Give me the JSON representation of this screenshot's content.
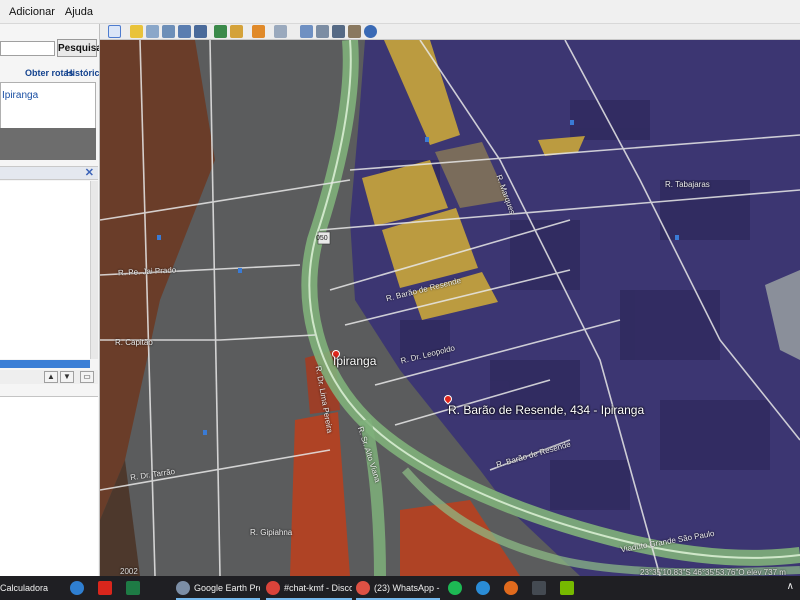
{
  "menu": {
    "items": [
      "Adicionar",
      "Ajuda"
    ]
  },
  "search": {
    "placeholder": "",
    "button_label": "Pesquisar"
  },
  "links": {
    "directions": "Obter rotas",
    "history": "Histórico"
  },
  "result": {
    "text": "Ipiranga"
  },
  "places_panel": {
    "close_glyph": "✕"
  },
  "map": {
    "labels": {
      "place": "Ipiranga",
      "address": "R. Barão de Resende, 434 - Ipiranga",
      "shield": "050"
    },
    "streets": [
      "R. Pe. Jai Prado",
      "R. Dr. Lima Pereira",
      "R. Dr. Tarrão",
      "R. Capitão",
      "R. Gipiahna",
      "R. Barão de Resende",
      "R. Dr. Leopoldo",
      "R. Barão de Resende",
      "R. Sr. Alto Viana",
      "Viaduto Grande São Paulo",
      "R. Tabajaras",
      "R. Marques"
    ],
    "year": "2002",
    "coords": "23°35'10.83\"S    46°35'53.76\"O    elev   737 m"
  },
  "taskbar": {
    "items": [
      {
        "label": "Calculadora",
        "color": "#3a3a3a"
      },
      {
        "label": "",
        "color": "#2f7fd1"
      },
      {
        "label": "",
        "color": "#d9261c"
      },
      {
        "label": "",
        "color": "#1e7b45"
      },
      {
        "label": "Google Earth Pro",
        "color": "#7c8ea6"
      },
      {
        "label": "#chat-kmf - Discord",
        "color": "#d9433a"
      },
      {
        "label": "(23) WhatsApp - G...",
        "color": "#dd5144"
      },
      {
        "label": "",
        "color": "#1db954"
      },
      {
        "label": "",
        "color": "#2a8cd6"
      },
      {
        "label": "",
        "color": "#e06a1d"
      },
      {
        "label": "",
        "color": "#444a52"
      },
      {
        "label": "",
        "color": "#76b900"
      }
    ],
    "tray": "∧"
  },
  "colors": {
    "industrial": "#3c3672",
    "residential": "#6b3a24",
    "commercial": "#b8401f",
    "selected_lots": "#c9a63b",
    "road_green": "#7fb07a"
  }
}
